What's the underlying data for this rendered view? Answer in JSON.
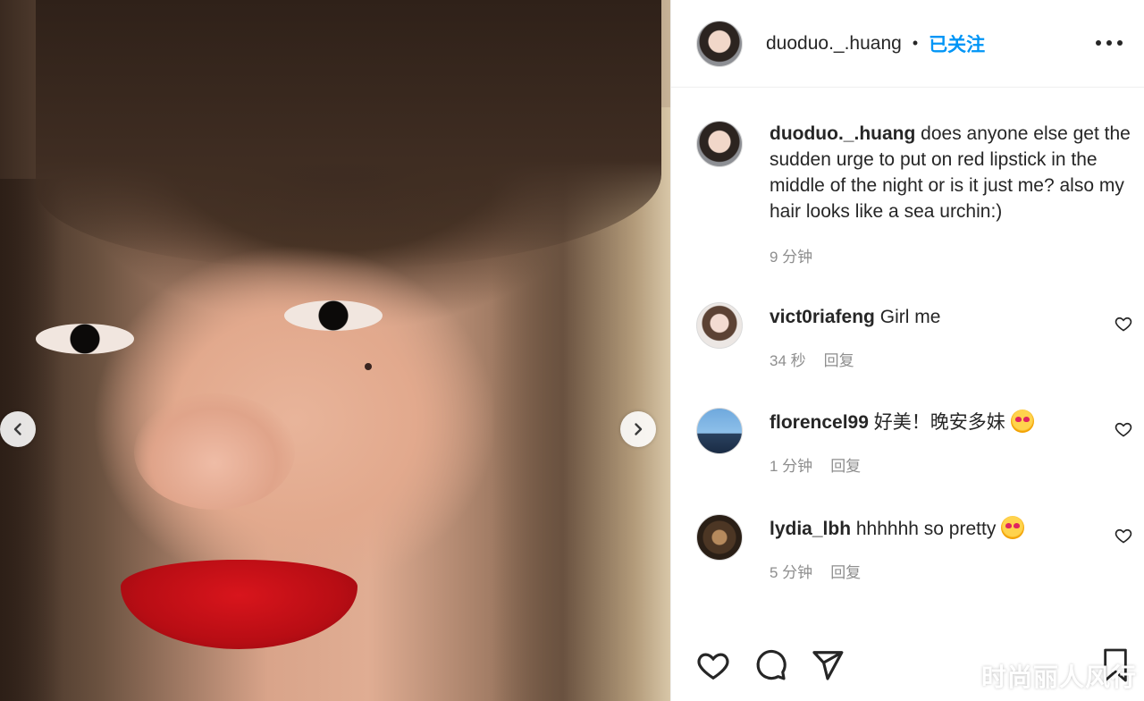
{
  "post": {
    "image_alt": "",
    "prev_icon": "chevron-left-icon",
    "next_icon": "chevron-right-icon"
  },
  "header": {
    "username": "duoduo._.huang",
    "separator": "•",
    "follow_label": "已关注",
    "more_icon": "more-horizontal-icon"
  },
  "caption": {
    "username": "duoduo._.huang",
    "text": "does anyone else get the sudden urge to put on red lipstick in the middle of the night or is it just me? also my hair looks like a sea urchin:)",
    "time": "9 分钟"
  },
  "comments": [
    {
      "username": "vict0riafeng",
      "text": "Girl me",
      "time": "34 秒",
      "reply_label": "回复",
      "emoji": ""
    },
    {
      "username": "florencel99",
      "text": "好美！晚安多妹",
      "time": "1 分钟",
      "reply_label": "回复",
      "emoji": "smiling-face-with-heart-eyes"
    },
    {
      "username": "lydia_lbh",
      "text": "hhhhhh so pretty",
      "time": "5 分钟",
      "reply_label": "回复",
      "emoji": "smiling-face-with-heart-eyes"
    }
  ],
  "actions": {
    "like_icon": "heart-icon",
    "comment_icon": "comment-icon",
    "share_icon": "send-icon",
    "save_icon": "bookmark-icon"
  },
  "watermark": "时尚丽人风行",
  "colors": {
    "accent": "#0095f6",
    "text": "#262626",
    "muted": "#8e8e8e",
    "lipstick": "#c8101a"
  }
}
